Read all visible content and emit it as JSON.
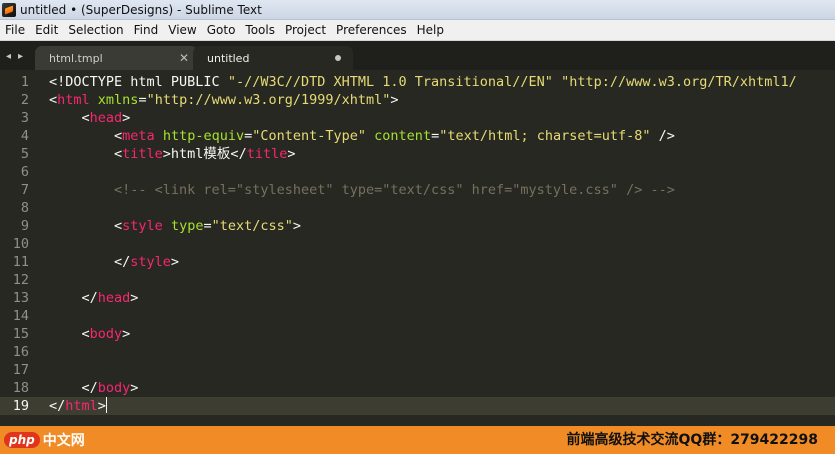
{
  "window": {
    "title": "untitled • (SuperDesigns) - Sublime Text"
  },
  "menu": {
    "items": [
      "File",
      "Edit",
      "Selection",
      "Find",
      "View",
      "Goto",
      "Tools",
      "Project",
      "Preferences",
      "Help"
    ]
  },
  "tabs": [
    {
      "label": "html.tmpl",
      "active": false,
      "close_glyph": "✕"
    },
    {
      "label": "untitled",
      "active": true,
      "dirty": true
    }
  ],
  "tab_nav": {
    "left_arrow": "◂",
    "right_arrow": "▸"
  },
  "editor": {
    "current_line": 19,
    "theme_colors": {
      "background": "#272822",
      "text": "#f8f8f2",
      "tag": "#f92672",
      "attribute": "#a6e22e",
      "string": "#e6db74",
      "comment": "#75715e"
    },
    "lines": [
      {
        "n": "1",
        "tokens": [
          [
            "tok-text",
            "<!DOCTYPE html PUBLIC "
          ],
          [
            "tok-string",
            "\"-//W3C//DTD XHTML 1.0 Transitional//EN\""
          ],
          [
            "tok-text",
            " "
          ],
          [
            "tok-string",
            "\"http://www.w3.org/TR/xhtml1/"
          ]
        ]
      },
      {
        "n": "2",
        "tokens": [
          [
            "tok-text",
            "<"
          ],
          [
            "tok-tag",
            "html"
          ],
          [
            "tok-text",
            " "
          ],
          [
            "tok-attr",
            "xmlns"
          ],
          [
            "tok-text",
            "="
          ],
          [
            "tok-string",
            "\"http://www.w3.org/1999/xhtml\""
          ],
          [
            "tok-text",
            ">"
          ]
        ]
      },
      {
        "n": "3",
        "tokens": [
          [
            "tok-text",
            "    <"
          ],
          [
            "tok-tag",
            "head"
          ],
          [
            "tok-text",
            ">"
          ]
        ]
      },
      {
        "n": "4",
        "tokens": [
          [
            "tok-text",
            "        <"
          ],
          [
            "tok-tag",
            "meta"
          ],
          [
            "tok-text",
            " "
          ],
          [
            "tok-attr",
            "http-equiv"
          ],
          [
            "tok-text",
            "="
          ],
          [
            "tok-string",
            "\"Content-Type\""
          ],
          [
            "tok-text",
            " "
          ],
          [
            "tok-attr",
            "content"
          ],
          [
            "tok-text",
            "="
          ],
          [
            "tok-string",
            "\"text/html; charset=utf-8\""
          ],
          [
            "tok-text",
            " />"
          ]
        ]
      },
      {
        "n": "5",
        "tokens": [
          [
            "tok-text",
            "        <"
          ],
          [
            "tok-tag",
            "title"
          ],
          [
            "tok-text",
            ">html模板</"
          ],
          [
            "tok-tag",
            "title"
          ],
          [
            "tok-text",
            ">"
          ]
        ]
      },
      {
        "n": "6",
        "tokens": []
      },
      {
        "n": "7",
        "tokens": [
          [
            "tok-comment",
            "        <!-- <link rel=\"stylesheet\" type=\"text/css\" href=\"mystyle.css\" /> -->"
          ]
        ]
      },
      {
        "n": "8",
        "tokens": []
      },
      {
        "n": "9",
        "tokens": [
          [
            "tok-text",
            "        <"
          ],
          [
            "tok-tag",
            "style"
          ],
          [
            "tok-text",
            " "
          ],
          [
            "tok-attr",
            "type"
          ],
          [
            "tok-text",
            "="
          ],
          [
            "tok-string",
            "\"text/css\""
          ],
          [
            "tok-text",
            ">"
          ]
        ]
      },
      {
        "n": "10",
        "tokens": []
      },
      {
        "n": "11",
        "tokens": [
          [
            "tok-text",
            "        </"
          ],
          [
            "tok-tag",
            "style"
          ],
          [
            "tok-text",
            ">"
          ]
        ]
      },
      {
        "n": "12",
        "tokens": []
      },
      {
        "n": "13",
        "tokens": [
          [
            "tok-text",
            "    </"
          ],
          [
            "tok-tag",
            "head"
          ],
          [
            "tok-text",
            ">"
          ]
        ]
      },
      {
        "n": "14",
        "tokens": []
      },
      {
        "n": "15",
        "tokens": [
          [
            "tok-text",
            "    <"
          ],
          [
            "tok-tag",
            "body"
          ],
          [
            "tok-text",
            ">"
          ]
        ]
      },
      {
        "n": "16",
        "tokens": []
      },
      {
        "n": "17",
        "tokens": []
      },
      {
        "n": "18",
        "tokens": [
          [
            "tok-text",
            "    </"
          ],
          [
            "tok-tag",
            "body"
          ],
          [
            "tok-text",
            ">"
          ]
        ]
      },
      {
        "n": "19",
        "tokens": [
          [
            "tok-text",
            "</"
          ],
          [
            "tok-tag",
            "html"
          ],
          [
            "tok-text",
            ">"
          ]
        ]
      }
    ]
  },
  "footer": {
    "logo_php": "php",
    "logo_cn": "中文网",
    "contact": "前端高级技术交流QQ群：279422298",
    "bar_color": "#f18b25"
  }
}
